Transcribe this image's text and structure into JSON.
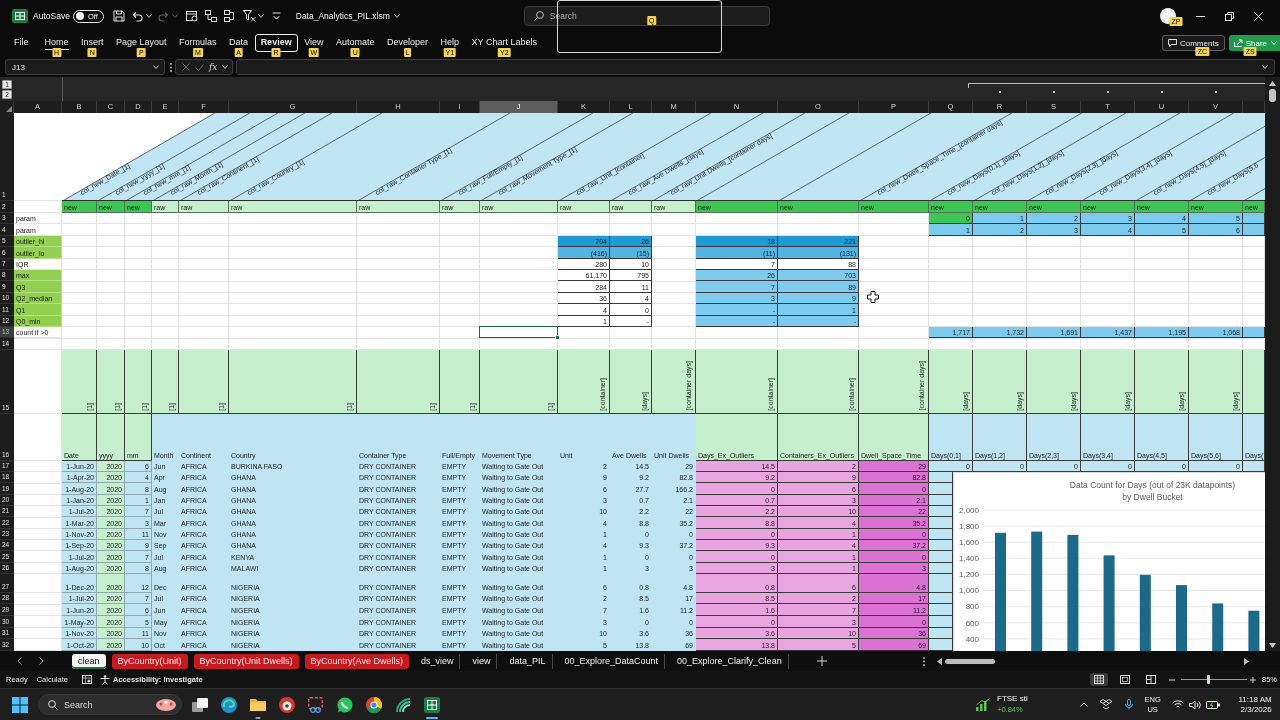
{
  "title_bar": {
    "autosave": {
      "label": "AutoSave",
      "toggle_label": "Off",
      "on": false
    },
    "file_name": "Data_Analytics_PIL.xlsm",
    "search": {
      "placeholder": "Search",
      "keytip": "Q"
    },
    "account_keytip": "ZP"
  },
  "ribbon": {
    "tabs": [
      {
        "label": "File",
        "selected": false,
        "focused": false
      },
      {
        "label": "Home",
        "keytip": "H",
        "selected": true,
        "focused": false
      },
      {
        "label": "Insert",
        "keytip": "N",
        "selected": false,
        "focused": false
      },
      {
        "label": "Page Layout",
        "keytip": "P",
        "selected": false,
        "focused": false
      },
      {
        "label": "Formulas",
        "keytip": "M",
        "selected": false,
        "focused": false
      },
      {
        "label": "Data",
        "keytip": "A",
        "selected": false,
        "focused": false
      },
      {
        "label": "Review",
        "keytip": "R",
        "selected": false,
        "focused": true
      },
      {
        "label": "View",
        "keytip": "W",
        "selected": false,
        "focused": false
      },
      {
        "label": "Automate",
        "keytip": "U",
        "selected": false,
        "focused": false
      },
      {
        "label": "Developer",
        "keytip": "L",
        "selected": false,
        "focused": false
      },
      {
        "label": "Help",
        "keytip": "Y1",
        "selected": false,
        "focused": false
      },
      {
        "label": "XY Chart Labels",
        "keytip": "Y2",
        "selected": false,
        "focused": false
      }
    ],
    "comments": {
      "label": "Comments",
      "keytip": "ZC"
    },
    "share": {
      "label": "Share",
      "keytip": "ZS"
    }
  },
  "formula_bar": {
    "name_box": "J13",
    "function_label": "fx"
  },
  "outline": {
    "levels": [
      "1",
      "2"
    ]
  },
  "sheet": {
    "columns": [
      {
        "letter": "A",
        "selected": false
      },
      {
        "letter": "B",
        "selected": false
      },
      {
        "letter": "C",
        "selected": false
      },
      {
        "letter": "D",
        "selected": false
      },
      {
        "letter": "E",
        "selected": false
      },
      {
        "letter": "F",
        "selected": false
      },
      {
        "letter": "G",
        "selected": false
      },
      {
        "letter": "H",
        "selected": false
      },
      {
        "letter": "I",
        "selected": false
      },
      {
        "letter": "J",
        "selected": true
      },
      {
        "letter": "K",
        "selected": false
      },
      {
        "letter": "L",
        "selected": false
      },
      {
        "letter": "M",
        "selected": false
      },
      {
        "letter": "N",
        "selected": false
      },
      {
        "letter": "O",
        "selected": false
      },
      {
        "letter": "P",
        "selected": false
      },
      {
        "letter": "Q",
        "selected": false
      },
      {
        "letter": "R",
        "selected": false
      },
      {
        "letter": "S",
        "selected": false
      },
      {
        "letter": "T",
        "selected": false
      },
      {
        "letter": "U",
        "selected": false
      },
      {
        "letter": "V",
        "selected": false
      }
    ],
    "rows": [
      {
        "number": "1",
        "selected": false,
        "kind": "slanted",
        "cells": {
          "B": "col_new_Date_[1]",
          "C": "col_new_yyyy_[1]",
          "D": "col_new_mm_[1]",
          "E": "col_raw_Month_[1]",
          "F": "col_raw_Continent_[1]",
          "G": "col_raw_Country_[1]",
          "H": "col_raw_Container Type_[1]",
          "I": "col_raw_Full/Empty_[1]",
          "J": "col_raw_Movement Type_[1]",
          "K": "col_raw_Unit_[container]",
          "L": "col_raw_Ave Dwells_[days]",
          "M": "col_raw_Unit Dwells_[container days]",
          "P": "col_new_Dwell_Space_Time_[container days]",
          "Q": "col_new_Days(0,1]_[days]",
          "R": "col_new_Days(1,2]_[days]",
          "S": "col_new_Days(2,3]_[days]",
          "T": "col_new_Days(3,4]_[days]",
          "U": "col_new_Days(4,5]_[days]",
          "V": "col_new_Days(5,6"
        }
      },
      {
        "number": "2",
        "selected": false,
        "kind": "labels",
        "cells": {
          "B": "new",
          "C": "new",
          "D": "new",
          "E": "raw",
          "F": "raw",
          "G": "raw",
          "H": "raw",
          "I": "raw",
          "J": "raw",
          "K": "raw",
          "L": "raw",
          "M": "raw",
          "N": "new",
          "O": "new",
          "P": "new",
          "Q": "new",
          "R": "new",
          "S": "new",
          "T": "new",
          "U": "new",
          "V": "new",
          "W": "new"
        }
      },
      {
        "number": "3",
        "selected": false,
        "kind": "values",
        "cells": {
          "A": "param",
          "Q": "0",
          "R": "1",
          "S": "2",
          "T": "3",
          "U": "4",
          "V": "5"
        }
      },
      {
        "number": "4",
        "selected": false,
        "kind": "values",
        "cells": {
          "A": "param",
          "Q": "1",
          "R": "2",
          "S": "3",
          "T": "4",
          "U": "5",
          "V": "6"
        }
      },
      {
        "number": "5",
        "selected": false,
        "kind": "values",
        "cells": {
          "A": "outlier_hi",
          "K": "704",
          "L": "26",
          "N": "18",
          "O": "221"
        }
      },
      {
        "number": "6",
        "selected": false,
        "kind": "values",
        "cells": {
          "A": "outlier_lo",
          "K": "(416)",
          "L": "(15)",
          "N": "(11)",
          "O": "(131)"
        }
      },
      {
        "number": "7",
        "selected": false,
        "kind": "values",
        "cells": {
          "A": "IQR",
          "K": "280",
          "L": "10",
          "N": "7",
          "O": "88"
        }
      },
      {
        "number": "8",
        "selected": false,
        "kind": "values",
        "cells": {
          "A": "max",
          "K": "61,170",
          "L": "795",
          "N": "26",
          "O": "703"
        }
      },
      {
        "number": "9",
        "selected": false,
        "kind": "values",
        "cells": {
          "A": "Q3",
          "K": "284",
          "L": "11",
          "N": "7",
          "O": "89"
        }
      },
      {
        "number": "10",
        "selected": false,
        "kind": "values",
        "cells": {
          "A": "Q2_median",
          "K": "36",
          "L": "4",
          "N": "3",
          "O": "9"
        }
      },
      {
        "number": "11",
        "selected": false,
        "kind": "values",
        "cells": {
          "A": "Q1",
          "K": "4",
          "L": "0",
          "N": "-",
          "O": "1"
        }
      },
      {
        "number": "12",
        "selected": false,
        "kind": "values",
        "cells": {
          "A": "Q0_min",
          "K": "1",
          "L": "-",
          "N": "-",
          "O": "-"
        }
      },
      {
        "number": "13",
        "selected": true,
        "kind": "values",
        "cells": {
          "A": "count if >0",
          "Q": "1,717",
          "R": "1,732",
          "S": "1,691",
          "T": "1,437",
          "U": "1,195",
          "V": "1,068"
        }
      },
      {
        "number": "14",
        "selected": false,
        "kind": "values",
        "cells": {}
      },
      {
        "number": "15",
        "selected": false,
        "kind": "units",
        "cells": {
          "B": "[1]",
          "C": "[1]",
          "D": "[1]",
          "E": "[1]",
          "F": "[1]",
          "G": "[1]",
          "H": "[1]",
          "I": "[1]",
          "J": "[1]",
          "K": "[container]",
          "L": "[days]",
          "M": "[container days]",
          "N": "[container]",
          "O": "[container]",
          "P": "[container days]",
          "Q": "[days]",
          "R": "[days]",
          "S": "[days]",
          "T": "[days]",
          "U": "[days]",
          "V": "[days]"
        }
      },
      {
        "number": "16",
        "selected": false,
        "kind": "labels",
        "cells": {
          "B": "Date",
          "C": "yyyy",
          "D": "mm",
          "E": "Month",
          "F": "Continent",
          "G": "Country",
          "H": "Container Type",
          "I": "Full/Empty",
          "J": "Movement Type",
          "K": "Unit",
          "L": "Ave Dwells",
          "M": "Unit Dwells",
          "N": "Days_Ex_Outliers",
          "O": "Containers_Ex_Outliers",
          "P": "Dwell_Space_Time",
          "Q": "Days(0,1]",
          "R": "Days(1,2]",
          "S": "Days(2,3]",
          "T": "Days(3,4]",
          "U": "Days(4,5]",
          "V": "Days(5,6]",
          "W": "Days("
        }
      },
      {
        "number": "17",
        "selected": false,
        "kind": "values",
        "cells": {
          "B": "1-Jun-20",
          "C": "2020",
          "D": "6",
          "E": "Jun",
          "F": "AFRICA",
          "G": "BURKINA FASO",
          "H": "DRY CONTAINER",
          "I": "EMPTY",
          "J": "Waiting to Gate Out",
          "K": "2",
          "L": "14.5",
          "M": "29",
          "N": "14.5",
          "O": "2",
          "P": "29",
          "Q": "0",
          "R": "0",
          "S": "0",
          "T": "0",
          "U": "0",
          "V": "0"
        }
      },
      {
        "number": "18",
        "selected": false,
        "kind": "values",
        "cells": {
          "B": "1-Apr-20",
          "C": "2020",
          "D": "4",
          "E": "Apr",
          "F": "AFRICA",
          "G": "GHANA",
          "H": "DRY CONTAINER",
          "I": "EMPTY",
          "J": "Waiting to Gate Out",
          "K": "9",
          "L": "9.2",
          "M": "82.8",
          "N": "9.2",
          "O": "9",
          "P": "82.8"
        }
      },
      {
        "number": "19",
        "selected": false,
        "kind": "values",
        "cells": {
          "B": "1-Aug-20",
          "C": "2020",
          "D": "8",
          "E": "Aug",
          "F": "AFRICA",
          "G": "GHANA",
          "H": "DRY CONTAINER",
          "I": "EMPTY",
          "J": "Waiting to Gate Out",
          "K": "6",
          "L": "27.7",
          "M": "166.2",
          "N": "0",
          "O": "6",
          "P": "0"
        }
      },
      {
        "number": "20",
        "selected": false,
        "kind": "values",
        "cells": {
          "B": "1-Jan-20",
          "C": "2020",
          "D": "1",
          "E": "Jan",
          "F": "AFRICA",
          "G": "GHANA",
          "H": "DRY CONTAINER",
          "I": "EMPTY",
          "J": "Waiting to Gate Out",
          "K": "3",
          "L": "0.7",
          "M": "2.1",
          "N": "0.7",
          "O": "3",
          "P": "2.1"
        }
      },
      {
        "number": "21",
        "selected": false,
        "kind": "values",
        "cells": {
          "B": "1-Jul-20",
          "C": "2020",
          "D": "7",
          "E": "Jul",
          "F": "AFRICA",
          "G": "GHANA",
          "H": "DRY CONTAINER",
          "I": "EMPTY",
          "J": "Waiting to Gate Out",
          "K": "10",
          "L": "2.2",
          "M": "22",
          "N": "2.2",
          "O": "10",
          "P": "22"
        }
      },
      {
        "number": "22",
        "selected": false,
        "kind": "values",
        "cells": {
          "B": "1-Mar-20",
          "C": "2020",
          "D": "3",
          "E": "Mar",
          "F": "AFRICA",
          "G": "GHANA",
          "H": "DRY CONTAINER",
          "I": "EMPTY",
          "J": "Waiting to Gate Out",
          "K": "4",
          "L": "8.8",
          "M": "35.2",
          "N": "8.8",
          "O": "4",
          "P": "35.2"
        }
      },
      {
        "number": "23",
        "selected": false,
        "kind": "values",
        "cells": {
          "B": "1-Nov-20",
          "C": "2020",
          "D": "11",
          "E": "Nov",
          "F": "AFRICA",
          "G": "GHANA",
          "H": "DRY CONTAINER",
          "I": "EMPTY",
          "J": "Waiting to Gate Out",
          "K": "1",
          "L": "0",
          "M": "0",
          "N": "0",
          "O": "1",
          "P": "0"
        }
      },
      {
        "number": "24",
        "selected": false,
        "kind": "values",
        "cells": {
          "B": "1-Sep-20",
          "C": "2020",
          "D": "9",
          "E": "Sep",
          "F": "AFRICA",
          "G": "GHANA",
          "H": "DRY CONTAINER",
          "I": "EMPTY",
          "J": "Waiting to Gate Out",
          "K": "4",
          "L": "9.3",
          "M": "37.2",
          "N": "9.3",
          "O": "4",
          "P": "37.2"
        }
      },
      {
        "number": "25",
        "selected": false,
        "kind": "values",
        "cells": {
          "B": "1-Jul-20",
          "C": "2020",
          "D": "7",
          "E": "Jul",
          "F": "AFRICA",
          "G": "KENYA",
          "H": "DRY CONTAINER",
          "I": "EMPTY",
          "J": "Waiting to Gate Out",
          "K": "1",
          "L": "0",
          "M": "0",
          "N": "0",
          "O": "1",
          "P": "0"
        }
      },
      {
        "number": "26",
        "selected": false,
        "kind": "values",
        "cells": {
          "B": "1-Aug-20",
          "C": "2020",
          "D": "8",
          "E": "Aug",
          "F": "AFRICA",
          "G": "MALAWI",
          "H": "DRY CONTAINER",
          "I": "EMPTY",
          "J": "Waiting to Gate Out",
          "K": "1",
          "L": "3",
          "M": "3",
          "N": "3",
          "O": "1",
          "P": "3"
        }
      },
      {
        "number": "27",
        "selected": false,
        "kind": "values",
        "cells": {
          "B": "1-Dec-20",
          "C": "2020",
          "D": "12",
          "E": "Dec",
          "F": "AFRICA",
          "G": "NIGERIA",
          "H": "DRY CONTAINER",
          "I": "EMPTY",
          "J": "Waiting to Gate Out",
          "K": "6",
          "L": "0.8",
          "M": "4.8",
          "N": "0.8",
          "O": "6",
          "P": "4.8"
        }
      },
      {
        "number": "28",
        "selected": false,
        "kind": "values",
        "cells": {
          "B": "1-Jul-20",
          "C": "2020",
          "D": "7",
          "E": "Jul",
          "F": "AFRICA",
          "G": "NIGERIA",
          "H": "DRY CONTAINER",
          "I": "EMPTY",
          "J": "Waiting to Gate Out",
          "K": "2",
          "L": "8.5",
          "M": "17",
          "N": "8.5",
          "O": "2",
          "P": "17"
        }
      },
      {
        "number": "29",
        "selected": false,
        "kind": "values",
        "cells": {
          "B": "1-Jun-20",
          "C": "2020",
          "D": "6",
          "E": "Jun",
          "F": "AFRICA",
          "G": "NIGERIA",
          "H": "DRY CONTAINER",
          "I": "EMPTY",
          "J": "Waiting to Gate Out",
          "K": "7",
          "L": "1.6",
          "M": "11.2",
          "N": "1.6",
          "O": "7",
          "P": "11.2"
        }
      },
      {
        "number": "30",
        "selected": false,
        "kind": "values",
        "cells": {
          "B": "1-May-20",
          "C": "2020",
          "D": "5",
          "E": "May",
          "F": "AFRICA",
          "G": "NIGERIA",
          "H": "DRY CONTAINER",
          "I": "EMPTY",
          "J": "Waiting to Gate Out",
          "K": "3",
          "L": "0",
          "M": "0",
          "N": "0",
          "O": "3",
          "P": "0"
        }
      },
      {
        "number": "31",
        "selected": false,
        "kind": "values",
        "cells": {
          "B": "1-Nov-20",
          "C": "2020",
          "D": "11",
          "E": "Nov",
          "F": "AFRICA",
          "G": "NIGERIA",
          "H": "DRY CONTAINER",
          "I": "EMPTY",
          "J": "Waiting to Gate Out",
          "K": "10",
          "L": "3.6",
          "M": "36",
          "N": "3.6",
          "O": "10",
          "P": "36"
        }
      },
      {
        "number": "32",
        "selected": false,
        "kind": "values",
        "cells": {
          "B": "1-Oct-20",
          "C": "2020",
          "D": "10",
          "E": "Oct",
          "F": "AFRICA",
          "G": "NIGERIA",
          "H": "DRY CONTAINER",
          "I": "EMPTY",
          "J": "Waiting to Gate Out",
          "K": "5",
          "L": "13.8",
          "M": "69",
          "N": "13.8",
          "O": "5",
          "P": "69"
        }
      }
    ],
    "chart": {
      "chart_data": {
        "type": "bar",
        "title": "Data Count for Days (out of 23K datapoints)\nby Dwell Bucket",
        "values": [
          1717,
          1732,
          1691,
          1437,
          1195,
          1068,
          840,
          750
        ],
        "ylim": [
          250,
          2000
        ],
        "yticks": [
          400,
          600,
          800,
          {
            "value": 1000,
            "label": "1,000"
          },
          {
            "value": 1200,
            "label": "1,200"
          },
          {
            "value": 1400,
            "label": "1,400"
          },
          {
            "value": 1600,
            "label": "1,600"
          },
          {
            "value": 1800,
            "label": "1,800"
          },
          {
            "value": 2000,
            "label": "2,000"
          }
        ],
        "grid": true
      }
    }
  },
  "sheet_tabs": [
    {
      "label": "clean",
      "selected": true
    },
    {
      "label": "ByCountry(Unit)",
      "selected": false,
      "color": "#c8191f"
    },
    {
      "label": "ByCountry(Unit Dwells)",
      "selected": false,
      "color": "#c8191f"
    },
    {
      "label": "ByCountry(Ave Dwells)",
      "selected": false,
      "color": "#c8191f"
    },
    {
      "label": "ds_view",
      "selected": false
    },
    {
      "label": "view",
      "selected": false
    },
    {
      "label": "data_PIL",
      "selected": false
    },
    {
      "label": "00_Explore_DataCount",
      "selected": false
    },
    {
      "label": "00_Explore_Clarify_Clean",
      "selected": false
    }
  ],
  "status_bar": {
    "mode": "Ready",
    "calculate": "Calculate",
    "accessibility": "Accessibility: Investigate",
    "views": [
      {
        "kind": "normal",
        "selected": true
      },
      {
        "kind": "page_layout",
        "selected": false
      },
      {
        "kind": "page_break",
        "selected": false
      }
    ],
    "zoom": {
      "label": "85%",
      "level": 0.42
    }
  },
  "taskbar": {
    "search": {
      "placeholder": "Search"
    },
    "apps": [
      {
        "kind": "task_view",
        "running": false,
        "active": false
      },
      {
        "kind": "swirl",
        "running": false,
        "active": false
      },
      {
        "kind": "folder",
        "running": true,
        "active": false
      },
      {
        "kind": "badge",
        "running": false,
        "active": false
      },
      {
        "kind": "snip",
        "running": false,
        "active": false
      },
      {
        "kind": "chat",
        "running": false,
        "active": false
      },
      {
        "kind": "ring",
        "running": false,
        "active": false
      },
      {
        "kind": "wave",
        "running": false,
        "active": false
      },
      {
        "kind": "sheet",
        "running": true,
        "active": true
      }
    ],
    "widget": {
      "name": "FTSE sti",
      "change": "+0.84%"
    },
    "language": {
      "code": "ENG",
      "region": "US"
    },
    "time": "11:18 AM",
    "date": "2/3/2026"
  }
}
